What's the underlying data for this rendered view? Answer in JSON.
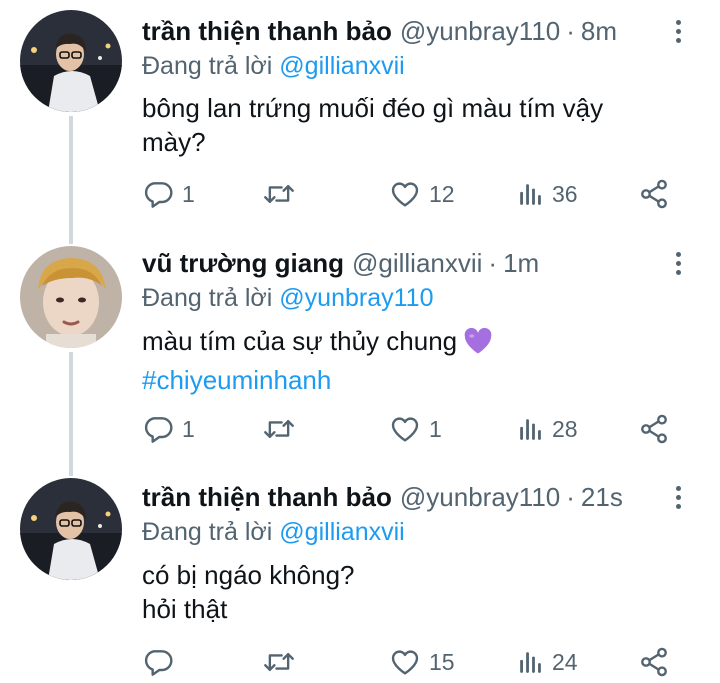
{
  "thread": [
    {
      "name": "trần thiện thanh bảo",
      "handle": "@yunbray110",
      "separator": "·",
      "time": "8m",
      "replying_prefix": "Đang trả lời",
      "replying_to": "@gillianxvii",
      "lines": [
        "bông lan trứng muối đéo gì màu tím vậy",
        "mày?"
      ],
      "replies": "1",
      "retweets": "",
      "likes": "12",
      "views": "36"
    },
    {
      "name": "vũ trường giang",
      "handle": "@gillianxvii",
      "separator": "·",
      "time": "1m",
      "replying_prefix": "Đang trả lời",
      "replying_to": "@yunbray110",
      "lines": [
        "màu tím của sự thủy chung"
      ],
      "emoji": "purple-heart",
      "hashtag": "#chiyeuminhanh",
      "replies": "1",
      "retweets": "",
      "likes": "1",
      "views": "28"
    },
    {
      "name": "trần thiện thanh bảo",
      "handle": "@yunbray110",
      "separator": "·",
      "time": "21s",
      "replying_prefix": "Đang trả lời",
      "replying_to": "@gillianxvii",
      "lines": [
        "có bị ngáo không?",
        "hỏi thật"
      ],
      "replies": "",
      "retweets": "",
      "likes": "15",
      "views": "24"
    }
  ],
  "colors": {
    "text": "#0f1419",
    "secondary": "#536471",
    "link": "#1d9bf0",
    "thread_line": "#cfd9de",
    "emoji": "#a66fe0"
  },
  "icons": [
    "reply-icon",
    "retweet-icon",
    "like-icon",
    "views-icon",
    "share-icon",
    "more-icon"
  ]
}
